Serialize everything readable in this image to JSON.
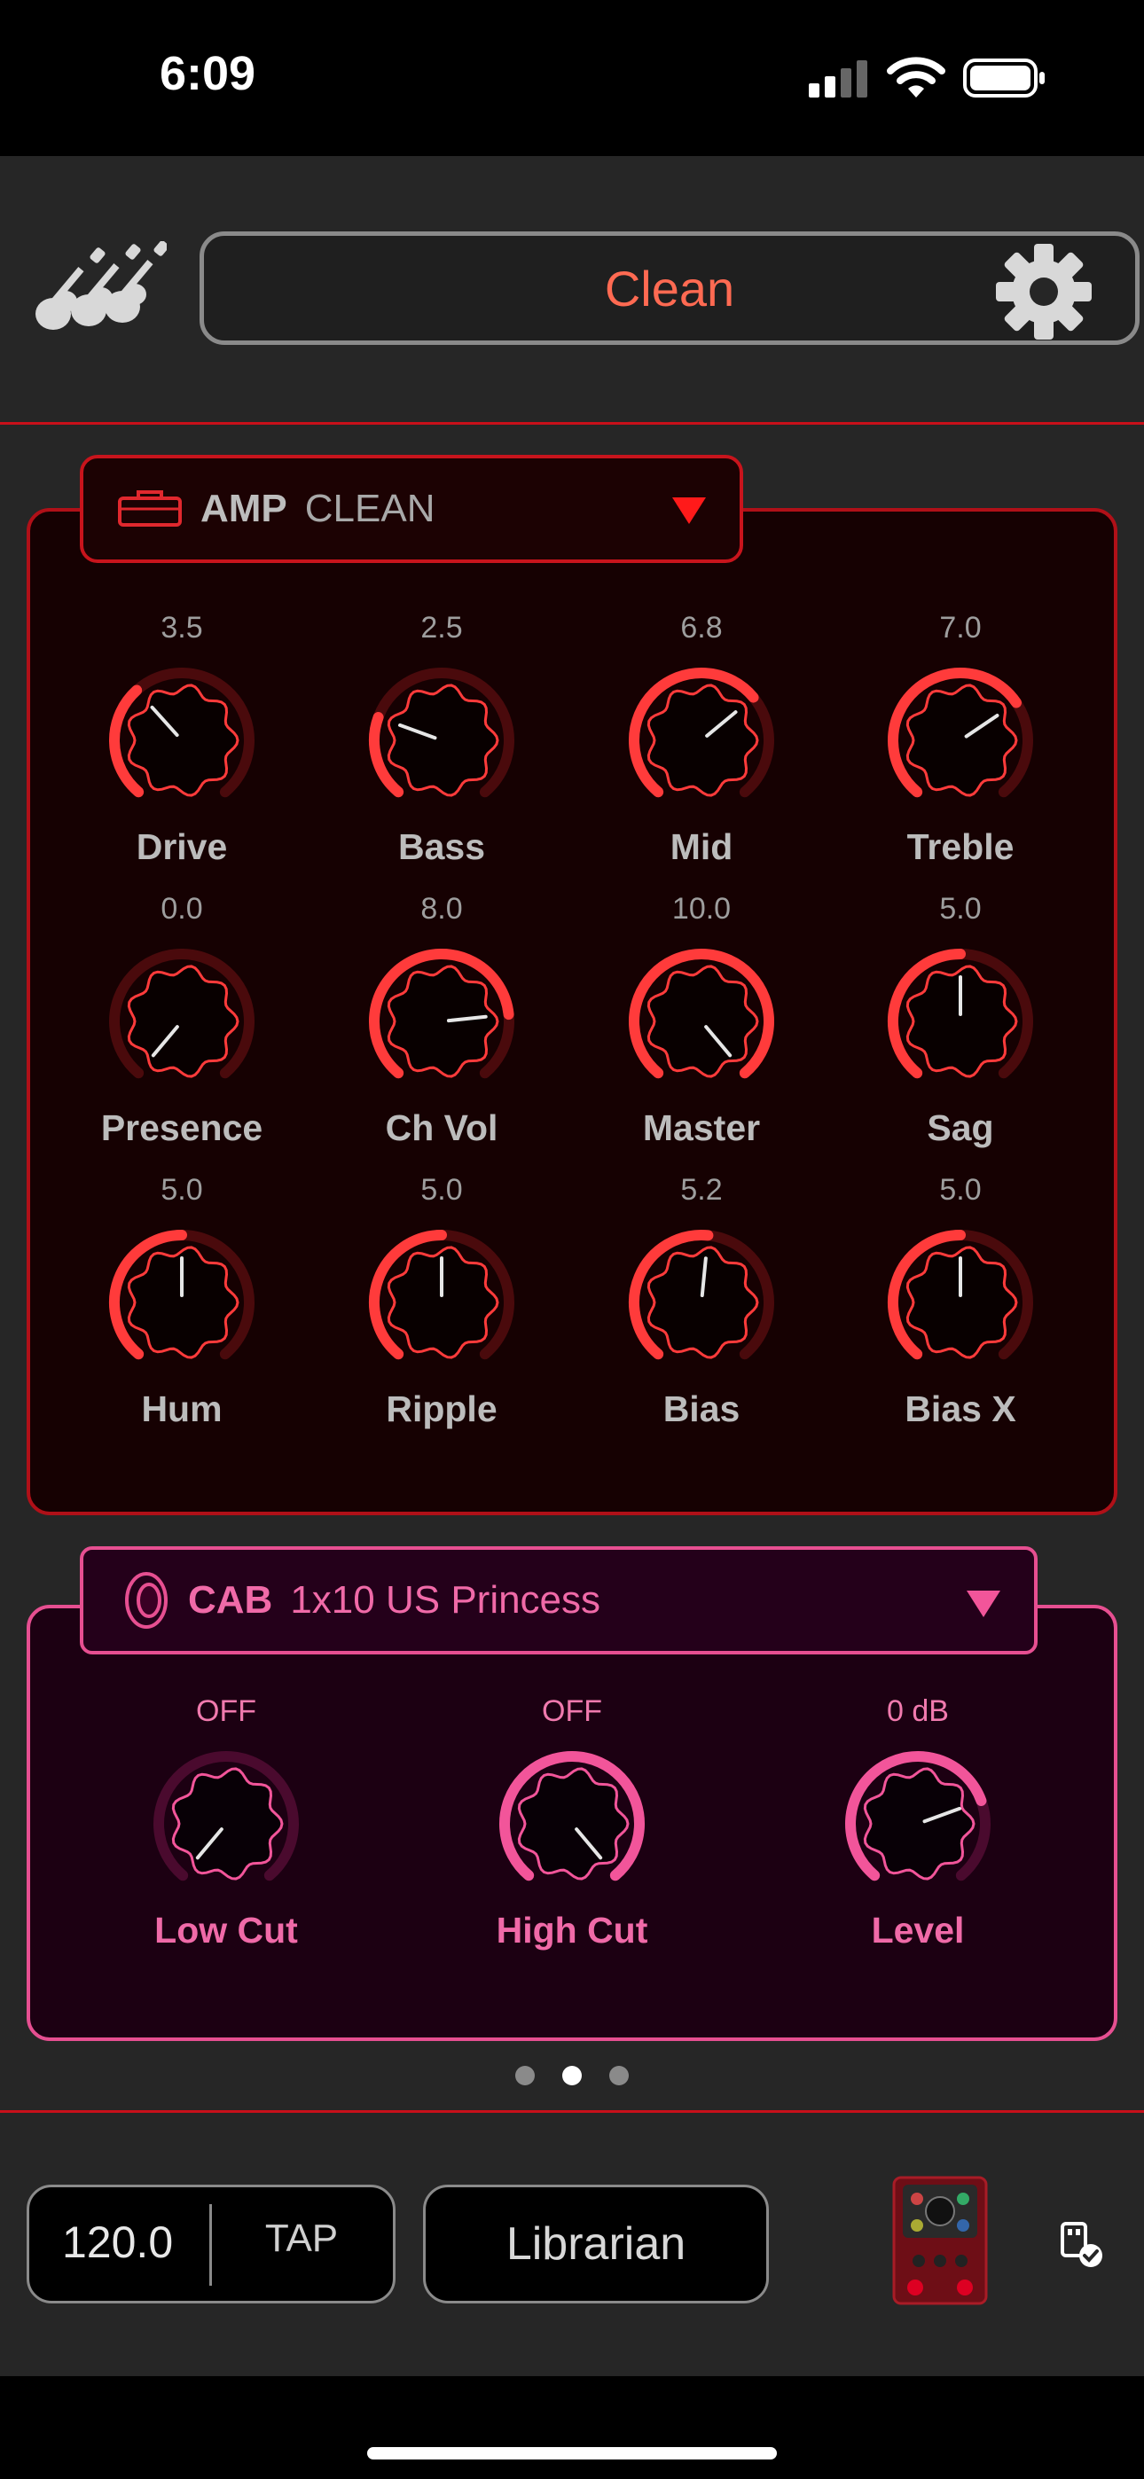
{
  "status_bar": {
    "time": "6:09"
  },
  "header": {
    "guitars_icon": "guitars-icon",
    "preset_name": "Clean",
    "settings_icon": "gear-icon"
  },
  "amp": {
    "label": "AMP",
    "model": "CLEAN",
    "icon": "amp-icon",
    "knobs": [
      {
        "label": "Drive",
        "value": "3.5"
      },
      {
        "label": "Bass",
        "value": "2.5"
      },
      {
        "label": "Mid",
        "value": "6.8"
      },
      {
        "label": "Treble",
        "value": "7.0"
      },
      {
        "label": "Presence",
        "value": "0.0"
      },
      {
        "label": "Ch Vol",
        "value": "8.0"
      },
      {
        "label": "Master",
        "value": "10.0"
      },
      {
        "label": "Sag",
        "value": "5.0"
      },
      {
        "label": "Hum",
        "value": "5.0"
      },
      {
        "label": "Ripple",
        "value": "5.0"
      },
      {
        "label": "Bias",
        "value": "5.2"
      },
      {
        "label": "Bias X",
        "value": "5.0"
      }
    ]
  },
  "cab": {
    "label": "CAB",
    "model": "1x10 US Princess",
    "icon": "speaker-icon",
    "knobs": [
      {
        "label": "Low Cut",
        "value": "OFF",
        "level": 0.0
      },
      {
        "label": "High Cut",
        "value": "OFF",
        "level": 1.0
      },
      {
        "label": "Level",
        "value": "0 dB",
        "level": 0.75
      }
    ]
  },
  "pager": {
    "count": 3,
    "active": 1
  },
  "footer": {
    "tempo": "120.0",
    "tap_label": "TAP",
    "librarian_label": "Librarian",
    "device_icon": "pedal-icon",
    "usb_icon": "usb-connected-icon"
  },
  "colors": {
    "amp_accent": "#ff3b3b",
    "cab_accent": "#f2559a",
    "preset_text": "#ff6a52"
  }
}
